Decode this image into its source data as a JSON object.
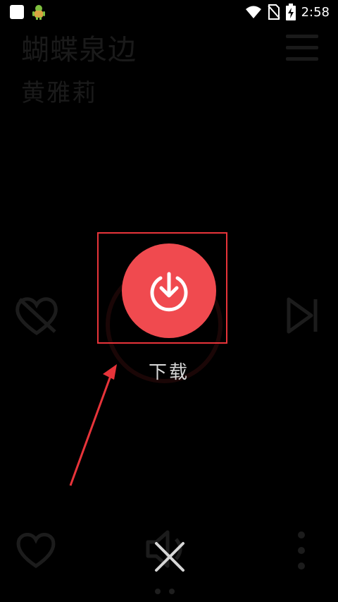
{
  "status_bar": {
    "time": "2:58",
    "icons": [
      "app-square-icon",
      "android-bug-icon",
      "wifi-icon",
      "no-sim-icon",
      "battery-charging-icon"
    ]
  },
  "player": {
    "song_title": "蝴蝶泉边",
    "artist": "黄雅莉"
  },
  "overlay": {
    "download_label": "下载"
  },
  "colors": {
    "accent_red": "#f04a4f",
    "highlight_red": "#e8343a",
    "background": "#000000"
  }
}
